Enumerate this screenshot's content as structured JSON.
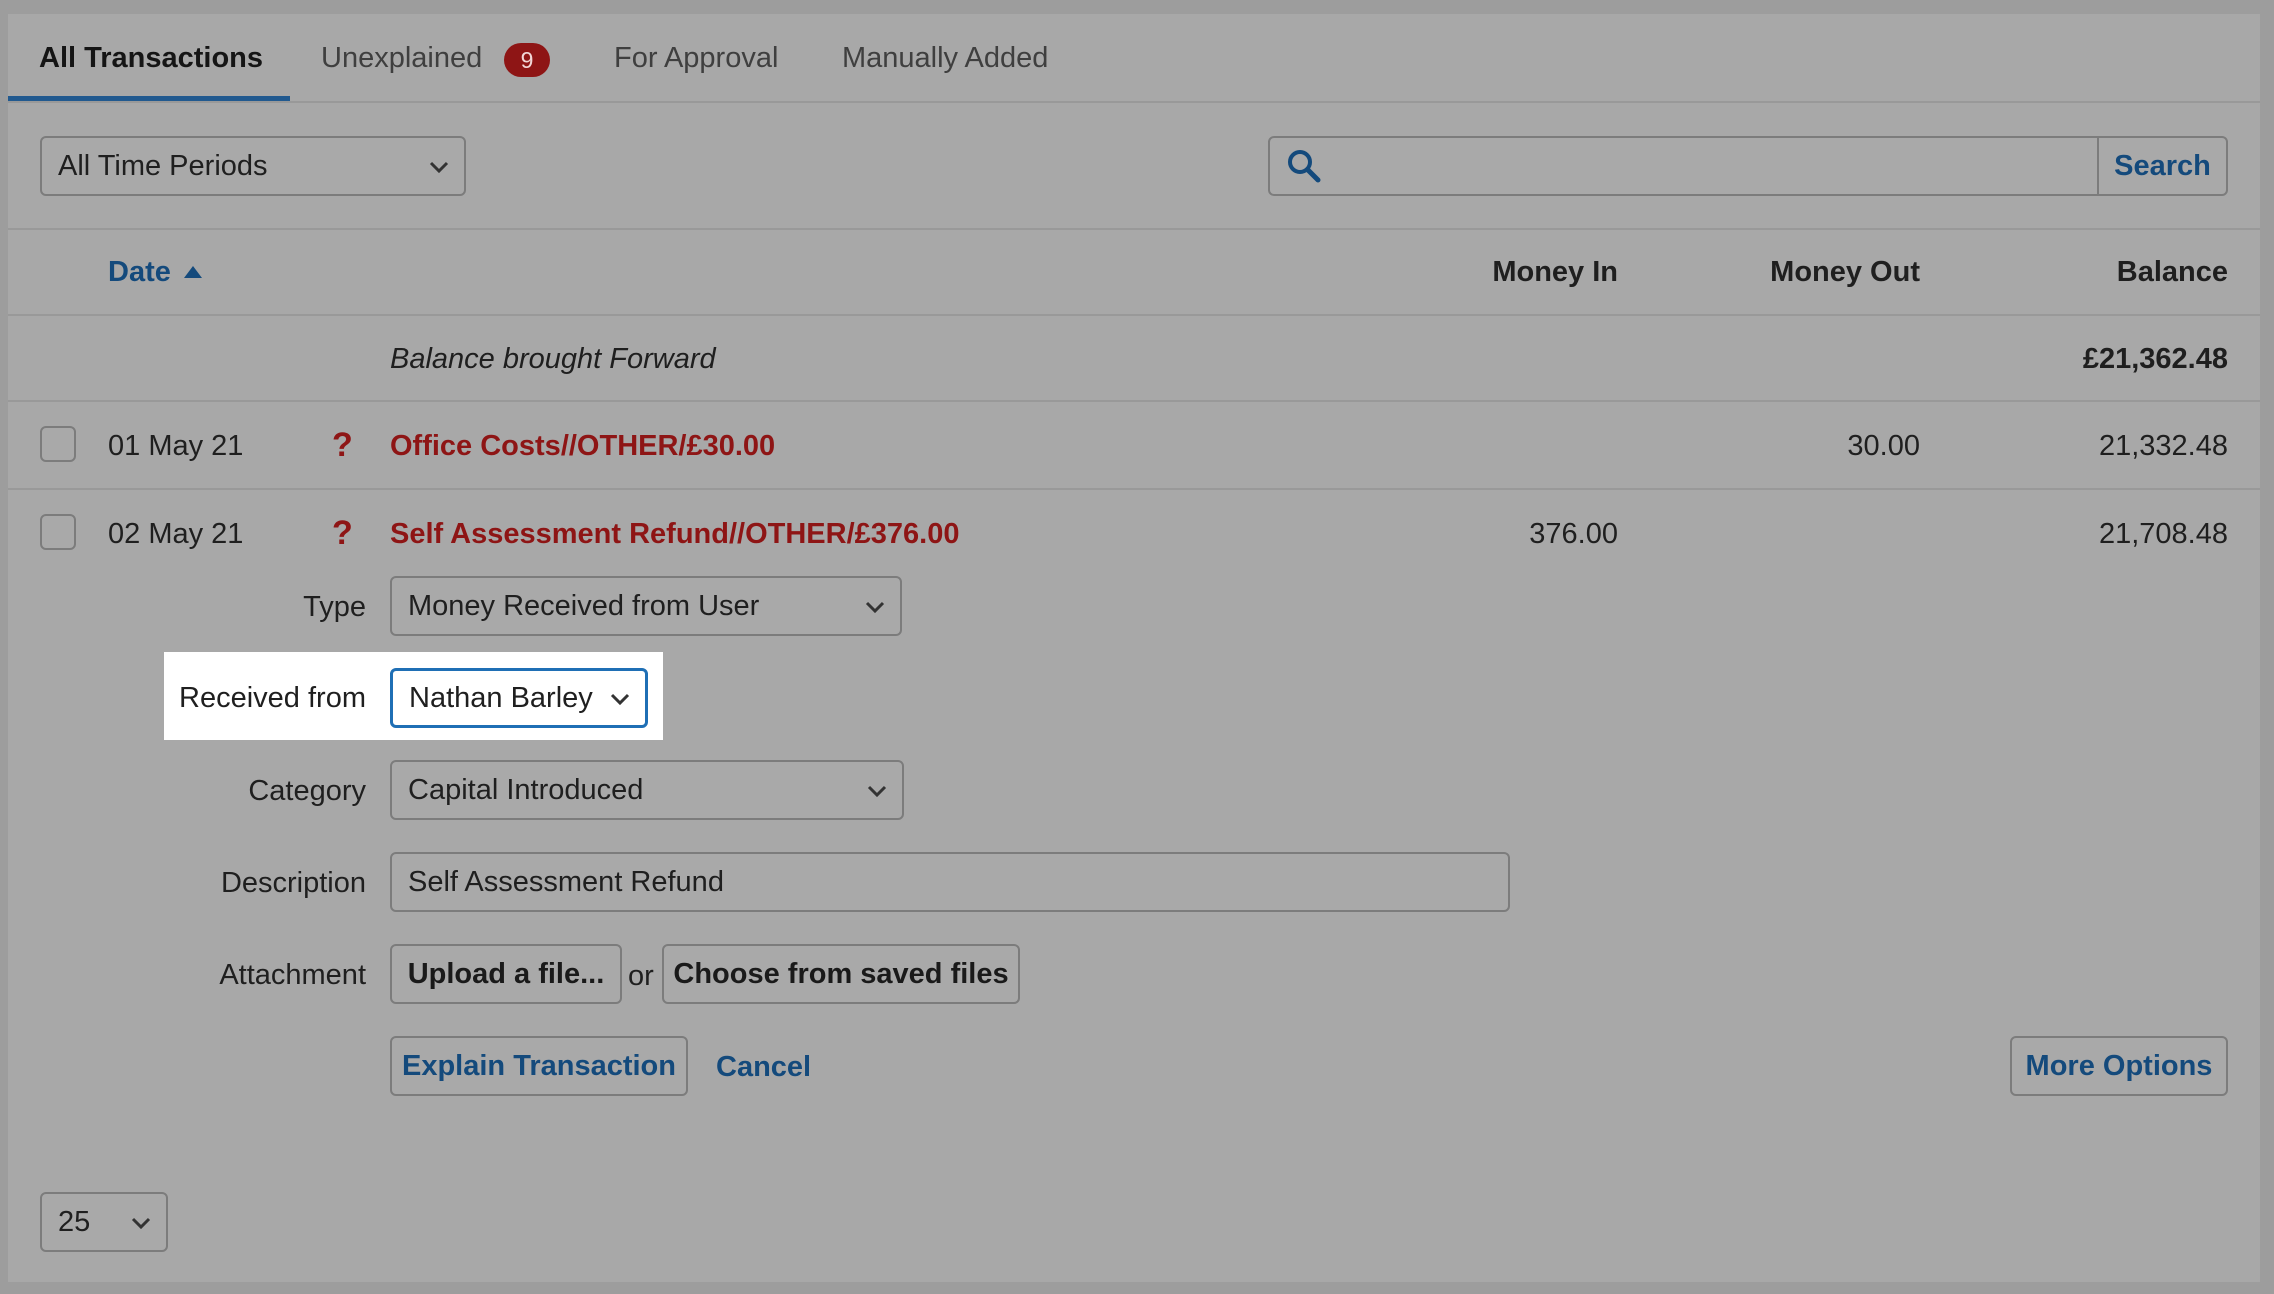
{
  "tabs": [
    {
      "label": "All Transactions"
    },
    {
      "label": "Unexplained",
      "badge": "9"
    },
    {
      "label": "For Approval"
    },
    {
      "label": "Manually Added"
    }
  ],
  "filters": {
    "period": "All Time Periods",
    "search_value": "",
    "search_button": "Search"
  },
  "table": {
    "headers": {
      "date": "Date",
      "money_in": "Money In",
      "money_out": "Money Out",
      "balance": "Balance"
    },
    "balance_forward": {
      "label": "Balance brought Forward",
      "balance": "£21,362.48"
    },
    "rows": [
      {
        "date": "01 May 21",
        "flag": "?",
        "description": "Office Costs//OTHER/£30.00",
        "money_in": "",
        "money_out": "30.00",
        "balance": "21,332.48"
      },
      {
        "date": "02 May 21",
        "flag": "?",
        "description": "Self Assessment Refund//OTHER/£376.00",
        "money_in": "376.00",
        "money_out": "",
        "balance": "21,708.48"
      }
    ]
  },
  "form": {
    "type_label": "Type",
    "type_value": "Money Received from User",
    "received_from_label": "Received from",
    "received_from_value": "Nathan Barley",
    "category_label": "Category",
    "category_value": "Capital Introduced",
    "description_label": "Description",
    "description_value": "Self Assessment Refund",
    "attachment_label": "Attachment",
    "upload_button": "Upload a file...",
    "or_text": "or",
    "choose_button": "Choose from saved files",
    "explain_button": "Explain Transaction",
    "cancel_link": "Cancel",
    "more_options_button": "More Options"
  },
  "pagination": {
    "per_page": "25"
  },
  "colors": {
    "accent": "#21598f",
    "alert": "#8e1515",
    "link": "#144a7c",
    "focus": "#1f6fb5"
  }
}
